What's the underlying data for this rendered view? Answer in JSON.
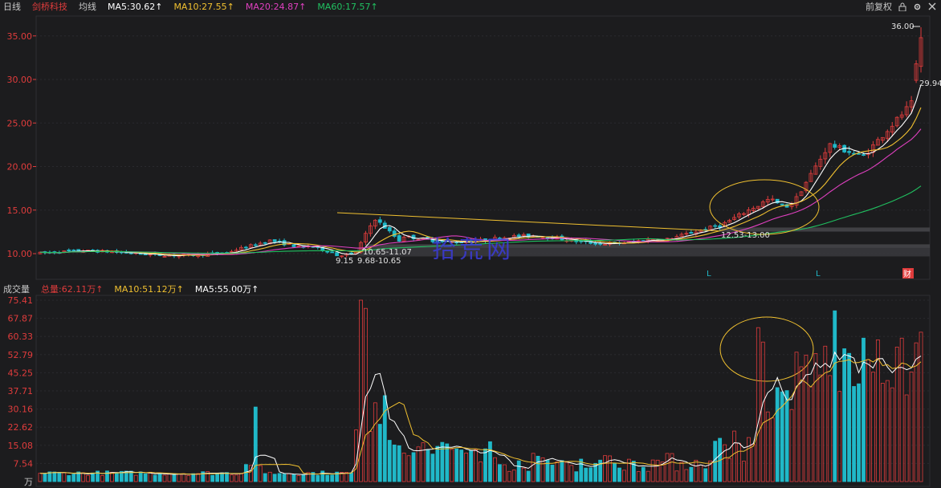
{
  "header": {
    "period": "日线",
    "stock_name": "剑桥科技",
    "ma_toggle": "均线",
    "ma5": "MA5:30.62↑",
    "ma10": "MA10:27.55↑",
    "ma20": "MA20:24.87↑",
    "ma60": "MA60:17.57↑",
    "restore": "前复权",
    "colors": {
      "ma5": "#ffffff",
      "ma10": "#f0c030",
      "ma20": "#e040c0",
      "ma60": "#20c060",
      "up": "#e03c3c",
      "down": "#20b8c8"
    }
  },
  "volume_header": {
    "title": "成交量",
    "total": "总量:62.11万↑",
    "ma10": "MA10:51.12万↑",
    "ma5": "MA5:55.00万↑"
  },
  "price_axis": [
    "35.00",
    "30.00",
    "25.00",
    "20.00",
    "15.00",
    "10.00"
  ],
  "volume_axis": [
    "75.41",
    "67.87",
    "60.33",
    "52.79",
    "45.25",
    "37.71",
    "30.16",
    "22.62",
    "15.08",
    "7.54",
    "万"
  ],
  "annotations": {
    "high": "36.00",
    "last": "29.94",
    "low": "9.15",
    "zone1": "9.68-10.65",
    "zone2": "10.65-11.07",
    "zone3": "12.53-13.00",
    "signal_l1": "L",
    "signal_l2": "L",
    "report": "财"
  },
  "watermark": "拾荒网",
  "chart_data": {
    "type": "candlestick",
    "y_range": [
      9,
      37
    ],
    "volume_range": [
      0,
      75.41
    ],
    "volume_unit": "万",
    "ma_last": {
      "ma5": 30.62,
      "ma10": 27.55,
      "ma20": 24.87,
      "ma60": 17.57
    },
    "period_high": 36.0,
    "period_low": 9.15,
    "latest_volume": 62.11
  }
}
